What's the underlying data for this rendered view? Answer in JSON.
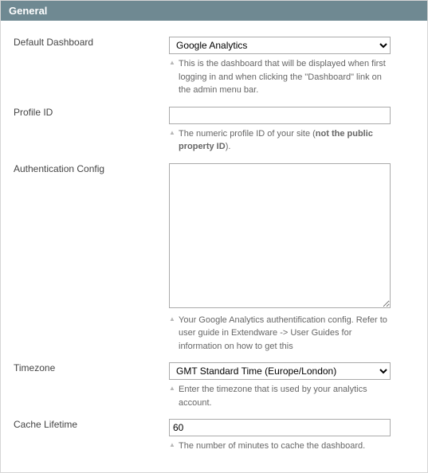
{
  "panel": {
    "title": "General"
  },
  "fields": {
    "default_dashboard": {
      "label": "Default Dashboard",
      "value": "Google Analytics",
      "hint": "This is the dashboard that will be displayed when first logging in and when clicking the \"Dashboard\" link on the admin menu bar."
    },
    "profile_id": {
      "label": "Profile ID",
      "value": "",
      "hint_prefix": "The numeric profile ID of your site (",
      "hint_bold": "not the public property ID",
      "hint_suffix": ")."
    },
    "auth_config": {
      "label": "Authentication Config",
      "value": "",
      "hint": "Your Google Analytics authentification config. Refer to user guide in Extendware -> User Guides for information on how to get this"
    },
    "timezone": {
      "label": "Timezone",
      "value": "GMT Standard Time (Europe/London)",
      "hint": "Enter the timezone that is used by your analytics account."
    },
    "cache_lifetime": {
      "label": "Cache Lifetime",
      "value": "60",
      "hint": "The number of minutes to cache the dashboard."
    }
  }
}
